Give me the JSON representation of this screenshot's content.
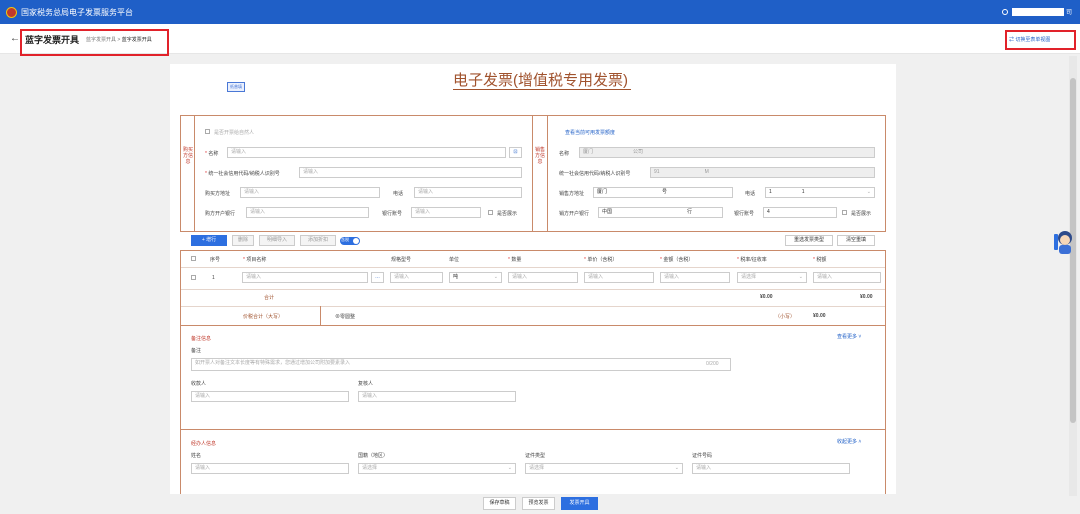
{
  "app": {
    "title": "国家税务总局电子发票服务平台",
    "user_suffix": "司"
  },
  "header": {
    "page_title": "蓝字发票开具",
    "crumb1": "蓝字发票开具",
    "crumb_sep": ">",
    "crumb2": "蓝字发票开具",
    "switch": "切换至表单视图",
    "back": "←"
  },
  "invoice": {
    "title": "电子发票(增值税专用发票)",
    "tag": "纸普填"
  },
  "buyer": {
    "side": "购买方信息",
    "natural": "是否开票给自然人",
    "name_label": "名称",
    "name_ph": "请输入",
    "tax_label": "统一社会信用代码/纳税人识别号",
    "tax_ph": "请输入",
    "addr_label": "购买方地址",
    "addr_ph": "请输入",
    "phone_label": "电话",
    "phone_ph": "请输入",
    "bank_label": "购方开户银行",
    "bank_ph": "请输入",
    "acct_label": "银行账号",
    "acct_ph": "请输入",
    "show": "是否展示"
  },
  "seller": {
    "side": "销售方信息",
    "link": "查看当前可用发票额度",
    "name_label": "名称",
    "name_val": "厦门",
    "name_val2": "公司",
    "tax_label": "统一社会信用代码/纳税人识别号",
    "tax_val": "91",
    "tax_val2": "M",
    "addr_label": "销售方地址",
    "addr_val": "厦门",
    "addr_val2": "号",
    "phone_label": "电话",
    "phone_val": "1",
    "phone_val2": "1",
    "bank_label": "销方开户银行",
    "bank_val": "中国",
    "bank_val2": "行",
    "acct_label": "银行账号",
    "acct_val": "4",
    "show": "是否展示"
  },
  "toolbar": {
    "add": "+ 增行",
    "del": "删除",
    "catalog": "明细导入",
    "discount": "添加折扣",
    "tax_incl": "含税",
    "reselect": "重选发票类型",
    "clear": "清空重填"
  },
  "table": {
    "headers": [
      "序号",
      "项目名称",
      "规格型号",
      "单位",
      "数量",
      "单价（含税）",
      "金额（含税）",
      "税率/征收率",
      "税额"
    ],
    "row": {
      "no": "1",
      "ph": "请输入",
      "unit": "吨",
      "rate": "请选择"
    },
    "total_label": "合计",
    "total_amount": "¥0.00",
    "total_tax": "¥0.00",
    "sum_label": "价税合计（大写）",
    "sum_upper": "⊗零圆整",
    "small_label": "（小写）",
    "small_val": "¥0.00"
  },
  "remarks": {
    "section": "备注信息",
    "more": "查看更多 ˅",
    "label": "备注",
    "ph": "如开票人对备注文本长度等有特殊需求，您通过增加公司附加要素录入",
    "count": "0/200",
    "payee": "收款人",
    "payee_ph": "请输入",
    "reviewer": "复核人",
    "reviewer_ph": "请输入"
  },
  "agent": {
    "section": "经办人信息",
    "collapse": "收起更多 ˄",
    "name": "姓名",
    "name_ph": "请输入",
    "country": "国籍（地区）",
    "country_ph": "请选择",
    "idtype": "证件类型",
    "idtype_ph": "请选择",
    "idno": "证件号码",
    "idno_ph": "请输入"
  },
  "footer": {
    "save": "保存草稿",
    "preview": "预览发票",
    "issue": "发票开具"
  }
}
